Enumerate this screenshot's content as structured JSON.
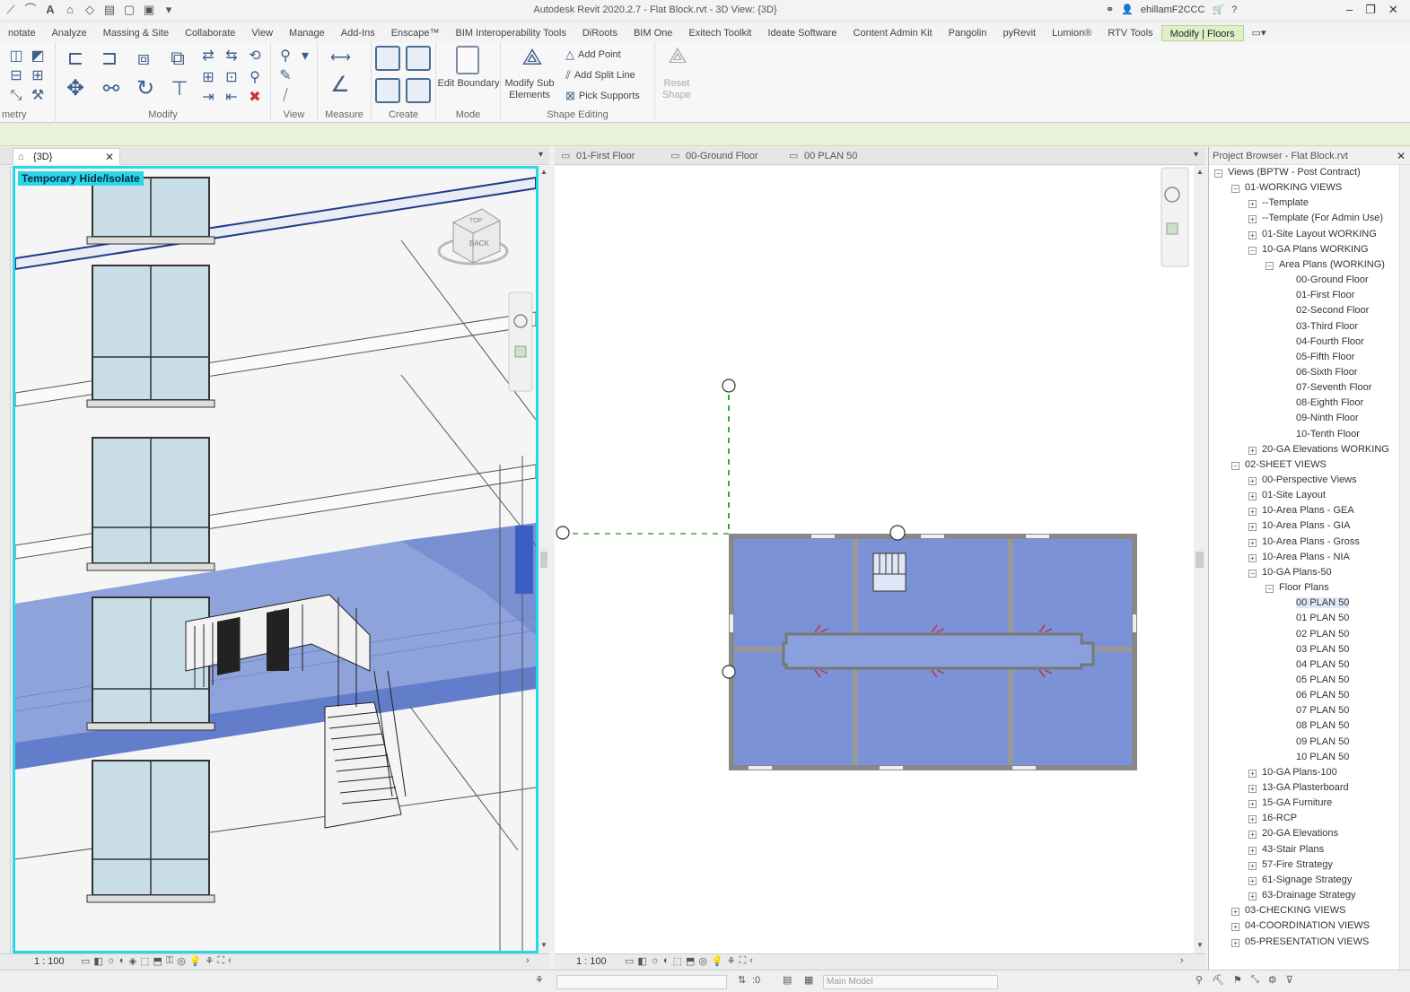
{
  "app": {
    "title": "Autodesk Revit 2020.2.7 - Flat Block.rvt - 3D View: {3D}",
    "user": "ehillamF2CCC"
  },
  "menu": {
    "tabs": [
      "notate",
      "Analyze",
      "Massing & Site",
      "Collaborate",
      "View",
      "Manage",
      "Add-Ins",
      "Enscape™",
      "BIM Interoperability Tools",
      "DiRoots",
      "BIM One",
      "Exitech Toolkit",
      "Ideate Software",
      "Content Admin Kit",
      "Pangolin",
      "pyRevit",
      "Lumion®",
      "RTV Tools",
      "Modify | Floors"
    ],
    "active": "Modify | Floors"
  },
  "ribbon": {
    "groups": {
      "geometry": "metry",
      "modify": "Modify",
      "view": "View",
      "measure": "Measure",
      "create": "Create",
      "mode": "Mode",
      "shape_editing": "Shape Editing"
    },
    "buttons": {
      "edit_boundary": "Edit Boundary",
      "modify_sub": "Modify Sub Elements",
      "add_point": "Add Point",
      "add_split_line": "Add Split Line",
      "pick_supports": "Pick Supports",
      "reset_shape": "Reset Shape"
    }
  },
  "views": {
    "left_tab": "{3D}",
    "right_tabs": [
      "01-First Floor",
      "00-Ground Floor",
      "00 PLAN 50"
    ],
    "hide_isolate": "Temporary Hide/Isolate",
    "viewcube_top": "TOP",
    "viewcube_back": "BACK",
    "left_scale": "1 : 100",
    "right_scale": "1 : 100"
  },
  "browser": {
    "title": "Project Browser - Flat Block.rvt",
    "nodes": [
      {
        "label": "Views (BPTW - Post Contract)",
        "level": 0,
        "exp": "-"
      },
      {
        "label": "01-WORKING VIEWS",
        "level": 1,
        "exp": "-"
      },
      {
        "label": "--Template",
        "level": 2,
        "exp": "+"
      },
      {
        "label": "--Template (For Admin Use)",
        "level": 2,
        "exp": "+"
      },
      {
        "label": "01-Site Layout WORKING",
        "level": 2,
        "exp": "+"
      },
      {
        "label": "10-GA Plans WORKING",
        "level": 2,
        "exp": "-"
      },
      {
        "label": "Area Plans (WORKING)",
        "level": 3,
        "exp": "-"
      },
      {
        "label": "00-Ground Floor",
        "level": 4,
        "exp": ""
      },
      {
        "label": "01-First Floor",
        "level": 4,
        "exp": ""
      },
      {
        "label": "02-Second Floor",
        "level": 4,
        "exp": ""
      },
      {
        "label": "03-Third Floor",
        "level": 4,
        "exp": ""
      },
      {
        "label": "04-Fourth Floor",
        "level": 4,
        "exp": ""
      },
      {
        "label": "05-Fifth Floor",
        "level": 4,
        "exp": ""
      },
      {
        "label": "06-Sixth Floor",
        "level": 4,
        "exp": ""
      },
      {
        "label": "07-Seventh Floor",
        "level": 4,
        "exp": ""
      },
      {
        "label": "08-Eighth Floor",
        "level": 4,
        "exp": ""
      },
      {
        "label": "09-Ninth Floor",
        "level": 4,
        "exp": ""
      },
      {
        "label": "10-Tenth Floor",
        "level": 4,
        "exp": ""
      },
      {
        "label": "20-GA Elevations WORKING",
        "level": 2,
        "exp": "+"
      },
      {
        "label": "02-SHEET VIEWS",
        "level": 1,
        "exp": "-"
      },
      {
        "label": "00-Perspective Views",
        "level": 2,
        "exp": "+"
      },
      {
        "label": "01-Site Layout",
        "level": 2,
        "exp": "+"
      },
      {
        "label": "10-Area Plans - GEA",
        "level": 2,
        "exp": "+"
      },
      {
        "label": "10-Area Plans - GIA",
        "level": 2,
        "exp": "+"
      },
      {
        "label": "10-Area Plans - Gross",
        "level": 2,
        "exp": "+"
      },
      {
        "label": "10-Area Plans - NIA",
        "level": 2,
        "exp": "+"
      },
      {
        "label": "10-GA Plans-50",
        "level": 2,
        "exp": "-"
      },
      {
        "label": "Floor Plans",
        "level": 3,
        "exp": "-"
      },
      {
        "label": "00 PLAN 50",
        "level": 4,
        "exp": "",
        "sel": true
      },
      {
        "label": "01 PLAN 50",
        "level": 4,
        "exp": ""
      },
      {
        "label": "02 PLAN 50",
        "level": 4,
        "exp": ""
      },
      {
        "label": "03 PLAN 50",
        "level": 4,
        "exp": ""
      },
      {
        "label": "04 PLAN 50",
        "level": 4,
        "exp": ""
      },
      {
        "label": "05 PLAN 50",
        "level": 4,
        "exp": ""
      },
      {
        "label": "06 PLAN 50",
        "level": 4,
        "exp": ""
      },
      {
        "label": "07 PLAN 50",
        "level": 4,
        "exp": ""
      },
      {
        "label": "08 PLAN 50",
        "level": 4,
        "exp": ""
      },
      {
        "label": "09 PLAN 50",
        "level": 4,
        "exp": ""
      },
      {
        "label": "10 PLAN 50",
        "level": 4,
        "exp": ""
      },
      {
        "label": "10-GA Plans-100",
        "level": 2,
        "exp": "+"
      },
      {
        "label": "13-GA Plasterboard",
        "level": 2,
        "exp": "+"
      },
      {
        "label": "15-GA Furniture",
        "level": 2,
        "exp": "+"
      },
      {
        "label": "16-RCP",
        "level": 2,
        "exp": "+"
      },
      {
        "label": "20-GA Elevations",
        "level": 2,
        "exp": "+"
      },
      {
        "label": "43-Stair Plans",
        "level": 2,
        "exp": "+"
      },
      {
        "label": "57-Fire Strategy",
        "level": 2,
        "exp": "+"
      },
      {
        "label": "61-Signage Strategy",
        "level": 2,
        "exp": "+"
      },
      {
        "label": "63-Drainage Strategy",
        "level": 2,
        "exp": "+"
      },
      {
        "label": "03-CHECKING VIEWS",
        "level": 1,
        "exp": "+"
      },
      {
        "label": "04-COORDINATION VIEWS",
        "level": 1,
        "exp": "+"
      },
      {
        "label": "05-PRESENTATION VIEWS",
        "level": 1,
        "exp": "+"
      }
    ]
  },
  "statusbar": {
    "count": ":0",
    "model": "Main Model"
  },
  "colors": {
    "accent_cyan": "#28d8e8",
    "floor_blue": "#7b93d6",
    "active_tab": "#dff0c8"
  }
}
